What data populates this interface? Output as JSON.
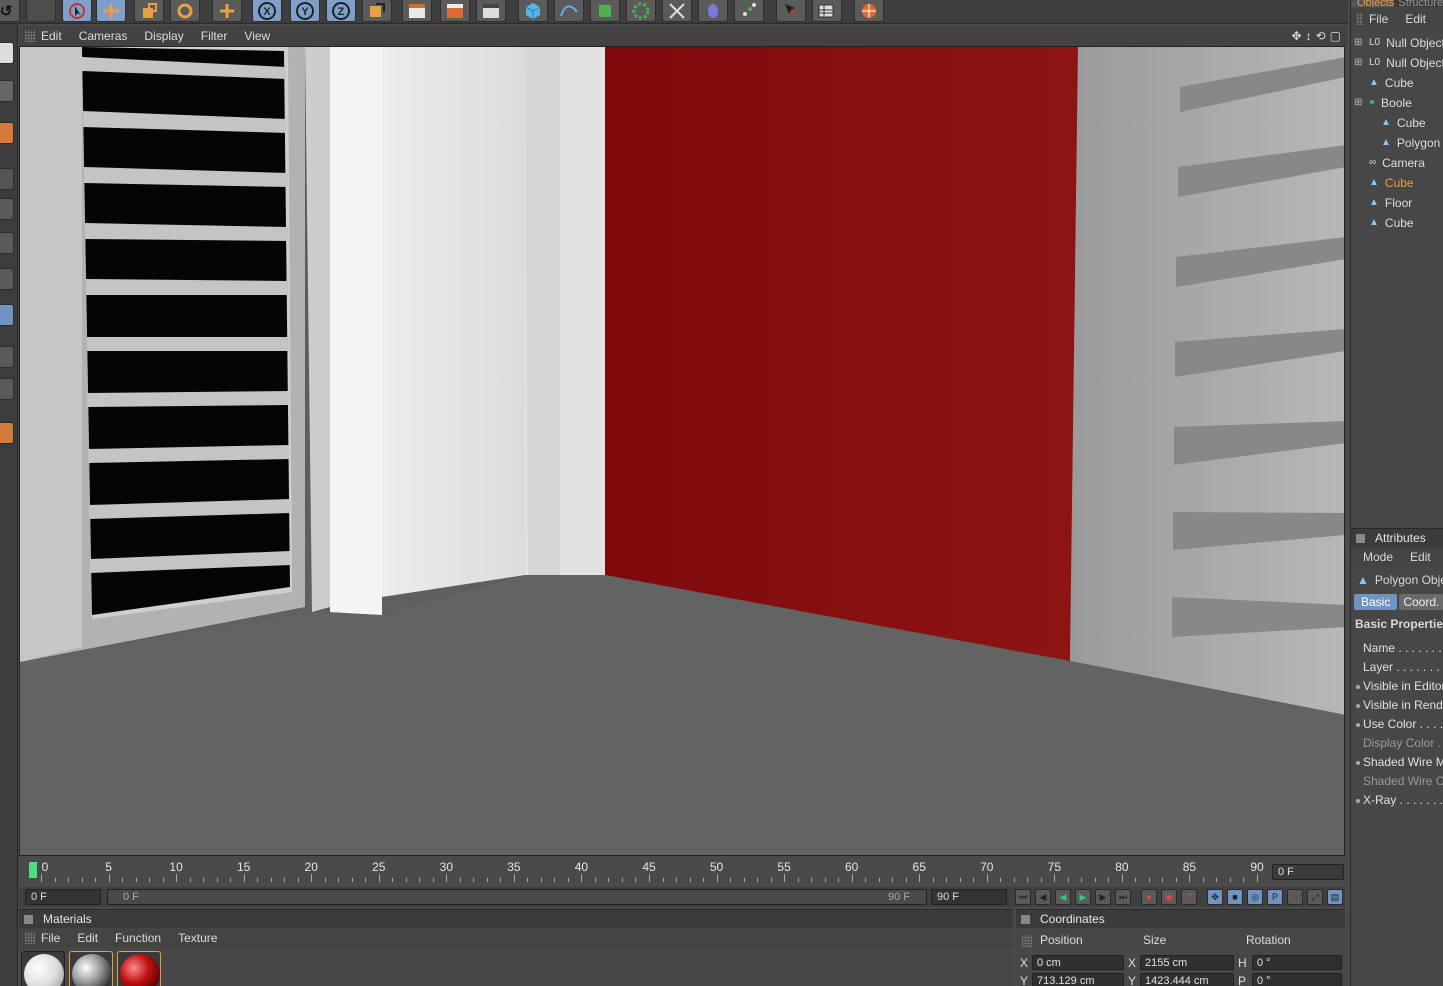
{
  "toolbar": {
    "icons": [
      "undo-icon",
      "redo-icon",
      "live-selection-icon",
      "move-icon",
      "scale-icon",
      "rotate-icon",
      "add-icon",
      "x-axis-icon",
      "y-axis-icon",
      "z-axis-icon",
      "world-coordinates-icon",
      "render-view-icon",
      "render-picture-viewer-icon",
      "render-settings-icon",
      "cube-primitive-icon",
      "spline-icon",
      "nurbs-icon",
      "modeling-array-icon",
      "deformer-icon",
      "scene-environment-icon",
      "particle-icon",
      "camera-light-icon",
      "tag-icon",
      "sketch-icon"
    ],
    "axis_labels": [
      "X",
      "Y",
      "Z"
    ]
  },
  "viewport": {
    "menu": [
      "Edit",
      "Cameras",
      "Display",
      "Filter",
      "View"
    ],
    "colors": {
      "red_wall": "#8a0f10",
      "white_wall": "#e6e6e6",
      "floor": "#626262"
    }
  },
  "timeline": {
    "ticks": [
      "0",
      "5",
      "10",
      "15",
      "20",
      "25",
      "30",
      "35",
      "40",
      "45",
      "50",
      "55",
      "60",
      "65",
      "70",
      "75",
      "80",
      "85",
      "90"
    ],
    "current_frame_field": "0 F"
  },
  "transport": {
    "start_field": "0 F",
    "range_start": "0 F",
    "range_end": "90 F",
    "end_field": "90 F"
  },
  "materials": {
    "title": "Materials",
    "menu": [
      "File",
      "Edit",
      "Function",
      "Texture"
    ],
    "swatches": [
      "white-material",
      "chrome-material",
      "red-material"
    ]
  },
  "coords": {
    "title": "Coordinates",
    "headers": [
      "Position",
      "Size",
      "Rotation"
    ],
    "row_x": {
      "axis": "X",
      "position": "0 cm",
      "size_axis": "X",
      "size": "2155 cm",
      "rot_axis": "H",
      "rotation": "0 °"
    },
    "row_y": {
      "axis": "Y",
      "position": "713.129 cm",
      "size_axis": "Y",
      "size": "1423.444 cm",
      "rot_axis": "P",
      "rotation": "0 °"
    }
  },
  "objects": {
    "tabs": [
      "Objects",
      "Structure"
    ],
    "menu": [
      "File",
      "Edit"
    ],
    "items": [
      {
        "label": "Null Object",
        "icon": "null-icon"
      },
      {
        "label": "Null Object",
        "icon": "null-icon"
      },
      {
        "label": "Cube",
        "icon": "polygon-icon"
      },
      {
        "label": "Boole",
        "icon": "boole-icon"
      },
      {
        "label": "Cube",
        "icon": "polygon-icon"
      },
      {
        "label": "Polygon",
        "icon": "polygon-icon"
      },
      {
        "label": "Camera",
        "icon": "camera-icon"
      },
      {
        "label": "Cube",
        "icon": "polygon-icon",
        "selected": true
      },
      {
        "label": "Floor",
        "icon": "polygon-icon"
      },
      {
        "label": "Cube",
        "icon": "polygon-icon"
      }
    ]
  },
  "attributes": {
    "title": "Attributes",
    "menu": [
      "Mode",
      "Edit"
    ],
    "object_type": "Polygon Object",
    "tabs": [
      "Basic",
      "Coord."
    ],
    "section": "Basic Properties",
    "props": [
      "Name . . . . . . . .",
      "Layer . . . . . . . .",
      "Visible in Editor",
      "Visible in Renderer",
      "Use Color . . . . .",
      "Display Color . .",
      "Shaded Wire Mode",
      "Shaded Wire Color",
      "X-Ray . . . . . . . ."
    ]
  }
}
